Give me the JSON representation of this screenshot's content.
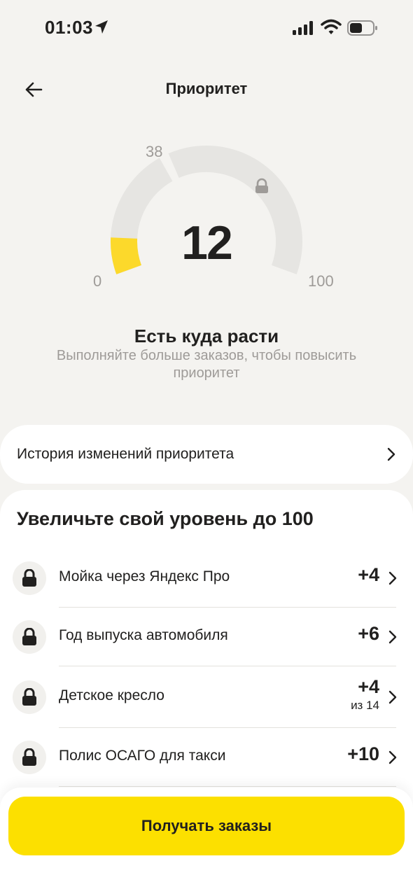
{
  "status_bar": {
    "time": "01:03",
    "icons": [
      "location-arrow-icon",
      "cellular-signal-icon",
      "wifi-icon",
      "battery-icon"
    ]
  },
  "header": {
    "title": "Приоритет",
    "back_icon": "arrow-left-icon"
  },
  "gauge": {
    "value": "12",
    "min_label": "0",
    "threshold_label": "38",
    "max_label": "100",
    "current": 12,
    "threshold": 38,
    "max": 100,
    "lock_icon": "lock-icon",
    "fill_color": "#fcd92b",
    "track_color": "#e6e5e2"
  },
  "status": {
    "title": "Есть куда расти",
    "subtitle": "Выполняйте больше заказов, чтобы повысить приоритет"
  },
  "history": {
    "label": "История изменений приоритета",
    "icon": "chevron-right-icon"
  },
  "tasks": {
    "title": "Увеличьте свой уровень до 100",
    "items": [
      {
        "label": "Мойка через Яндекс Про",
        "points": "+4",
        "sub": "",
        "icon": "lock-icon"
      },
      {
        "label": "Год выпуска автомобиля",
        "points": "+6",
        "sub": "",
        "icon": "lock-icon"
      },
      {
        "label": "Детское кресло",
        "points": "+4",
        "sub": "из 14",
        "icon": "lock-icon"
      },
      {
        "label": "Полис ОСАГО для такси",
        "points": "+10",
        "sub": "",
        "icon": "lock-icon"
      }
    ]
  },
  "cta": {
    "label": "Получать заказы"
  },
  "colors": {
    "accent": "#fce000",
    "background": "#f4f3f0",
    "text": "#21201f",
    "muted": "#9e9b98"
  }
}
